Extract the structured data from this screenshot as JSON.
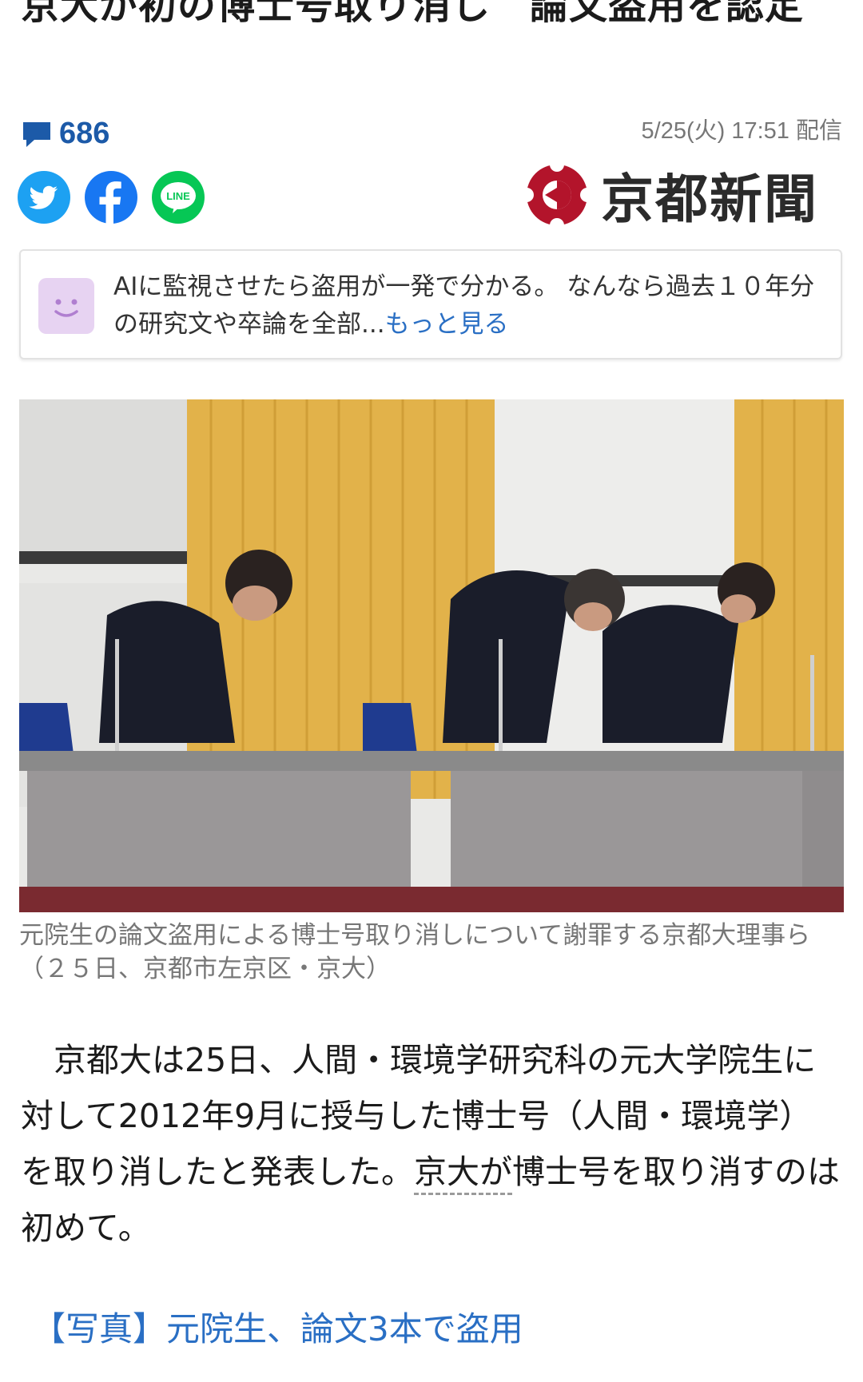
{
  "article": {
    "headline": "京大が初の博士号取り消し　論文盗用を認定",
    "comment_count": "686",
    "published": "5/25(火) 17:51 配信",
    "publisher": "京都新聞"
  },
  "share": {
    "line_label": "LINE"
  },
  "ai_summary": {
    "text": "AIに監視させたら盗用が一発で分かる。 なんなら過去１０年分の研究文や卒論を全部...",
    "more_label": "もっと見る"
  },
  "photo": {
    "caption": "元院生の論文盗用による博士号取り消しについて謝罪する京都大理事ら（２５日、京都市左京区・京大）"
  },
  "body": {
    "text_1": "　京都大は25日、人間・環境学研究科の元大学院生に対して2012年9月に授与した博士号（人間・環境学）を取り消したと発表した。",
    "linked_phrase": "京大が",
    "text_2": "博士号を取り消すのは初めて。"
  },
  "related": {
    "link_label": "【写真】元院生、論文3本で盗用"
  },
  "colors": {
    "link_blue": "#2a6fc4",
    "twitter": "#1da1f2",
    "facebook": "#1877f2",
    "line": "#06c755",
    "kyoto_shimbun_red": "#b3142b",
    "curtain_yellow": "#e2b24a"
  }
}
